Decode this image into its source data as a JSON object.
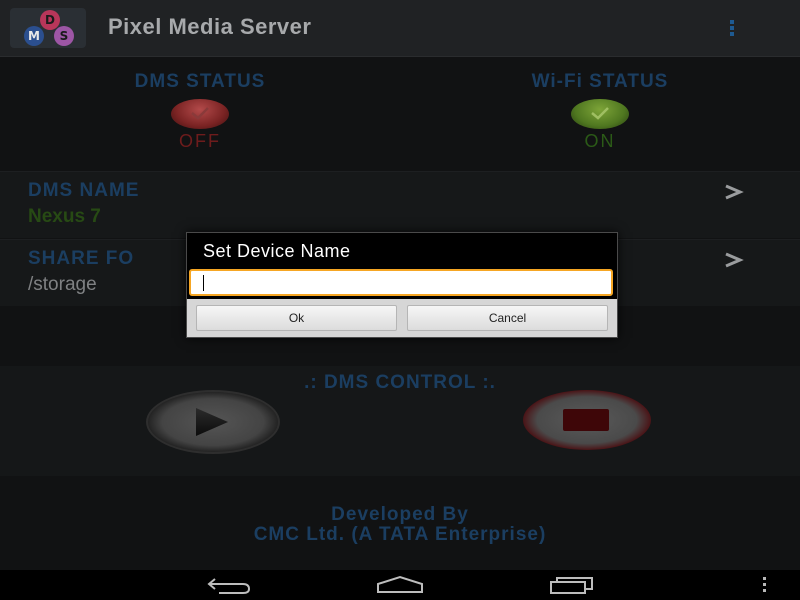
{
  "app": {
    "title": "Pixel Media Server",
    "logo_letters": {
      "d": "D",
      "m": "M",
      "s": "S"
    }
  },
  "status": {
    "dms": {
      "title": "DMS STATUS",
      "value": "OFF",
      "color": "#7a2323"
    },
    "wifi": {
      "title": "Wi-Fi STATUS",
      "value": "ON",
      "color": "#4f7720"
    }
  },
  "settings": {
    "dms_name": {
      "label": "DMS NAME",
      "value": "Nexus 7"
    },
    "share_folder": {
      "label": "SHARE FO",
      "value": "/storage"
    }
  },
  "control": {
    "title": ".: DMS CONTROL :."
  },
  "footer": {
    "line1": "Developed By",
    "line2": "CMC Ltd. (A TATA Enterprise)"
  },
  "dialog": {
    "title": "Set Device Name",
    "input_value": "",
    "ok_label": "Ok",
    "cancel_label": "Cancel"
  },
  "colors": {
    "section_header": "#1b3e61",
    "dialog_focus": "#f6a623"
  },
  "icons": {
    "overflow": "overflow-menu-icon",
    "back": "back-icon",
    "home": "home-icon",
    "recent": "recent-apps-icon"
  }
}
